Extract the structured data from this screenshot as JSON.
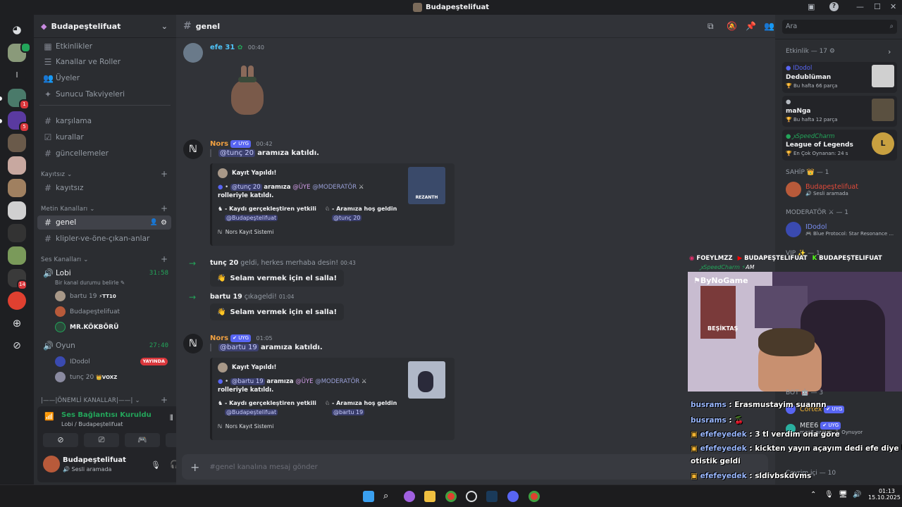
{
  "window": {
    "title": "Budapeştelifuat"
  },
  "server": {
    "name": "Budapeştelifuat",
    "top_items": [
      "Etkinlikler",
      "Kanallar ve Roller",
      "Üyeler",
      "Sunucu Takviyeleri"
    ],
    "channels_a": [
      "karşılama",
      "kurallar",
      "güncellemeler"
    ],
    "cat_kayitsiz": "Kayıtsız",
    "ch_kayitsiz": "kayıtsız",
    "cat_metin": "Metin Kanalları",
    "ch_genel": "genel",
    "ch_klipler": "klipler-ve-öne-çıkan-anlar",
    "cat_ses": "Ses Kanalları",
    "lobi": {
      "name": "Lobi",
      "time": "31:58",
      "status": "Bir kanal durumu belirle",
      "users": [
        "bartu 19",
        "Budapeştelifuat",
        "MR.KÖKBÖRÜ"
      ],
      "bartu_tag": "TT10"
    },
    "oyun": {
      "name": "Oyun",
      "time": "27:40",
      "users": [
        "IDodol",
        "tunç 20"
      ],
      "idodol_tag": "YAYINDA",
      "tunc_tag": "VOXZ"
    },
    "cat_onemli": "|——|ÖNEMLİ KANALLAR|——|",
    "rail_badges": [
      "1",
      "5",
      "14"
    ]
  },
  "voice": {
    "status": "Ses Bağlantısı Kuruldu",
    "sub": "Lobi / Budapeştelifuat"
  },
  "user": {
    "name": "Budapeştelifuat",
    "status": "Sesli aramada"
  },
  "header": {
    "channel": "genel",
    "search_placeholder": "Ara"
  },
  "messages": {
    "m1": {
      "name": "efe 31",
      "time": "00:40"
    },
    "m2": {
      "name": "Nors",
      "tag": "UYG",
      "time": "00:42",
      "mention": "@tunç 20",
      "text": "aramıza katıldı."
    },
    "embed1": {
      "title": "Kayıt Yapıldı!",
      "mention": "@tunç 20",
      "aramiza": "aramıza",
      "role1": "@ÜYE",
      "role2": "@MODERATÖR",
      "tail": "rolleriyle katıldı.",
      "f1": "- Kaydı gerçekleştiren yetkili",
      "f1v": "@Budapeştelifuat",
      "f2": "- Aramıza hoş geldin",
      "f2v": "@tunç 20",
      "footer": "Nors Kayıt Sistemi",
      "thumb": "REZANTH"
    },
    "j1": {
      "name": "tunç 20",
      "text": "geldi, herkes merhaba desin!",
      "time": "00:43",
      "btn": "Selam vermek için el salla!"
    },
    "j2": {
      "name": "bartu 19",
      "text": "çıkageldi!",
      "time": "01:04",
      "btn": "Selam vermek için el salla!"
    },
    "m3": {
      "name": "Nors",
      "tag": "UYG",
      "time": "01:05",
      "mention": "@bartu 19",
      "text": "aramıza katıldı."
    },
    "embed2": {
      "title": "Kayıt Yapıldı!",
      "mention": "@bartu 19",
      "aramiza": "aramıza",
      "role1": "@ÜYE",
      "role2": "@MODERATÖR",
      "tail": "rolleriyle katıldı.",
      "f1": "- Kaydı gerçekleştiren yetkili",
      "f1v": "@Budapeştelifuat",
      "f2": "- Aramıza hoş geldin",
      "f2v": "@bartu 19",
      "footer": "Nors Kayıt Sistemi"
    }
  },
  "composer": {
    "placeholder": "#genel kanalına mesaj gönder"
  },
  "members": {
    "activity_hdr": "Etkinlik — 17",
    "acts": [
      {
        "user": "IDodol",
        "title": "Dedublüman",
        "sub": "Bu hafta 66 parça"
      },
      {
        "user": "",
        "title": "maNga",
        "sub": "Bu hafta 12 parça"
      },
      {
        "user": "ꭙSpeedCharm",
        "title": "League of Legends",
        "sub": "En Çok Oynanan: 24 s"
      }
    ],
    "sahip_hdr": "SAHİP 👑 — 1",
    "sahip_name": "Budapeştelifuat",
    "sahip_sub": "Sesli aramada",
    "mod_hdr": "MODERATÖR ⚔ — 1",
    "mod_name": "IDodol",
    "mod_sub": "Blue Protocol: Star Resonance ...",
    "vip_hdr": "VIP ✨ — 1",
    "bot_hdr": "BOT 🤖 — 3",
    "bot1": "Cortex",
    "bot2": "MEE6",
    "bot2_sub": "mee6-games",
    "bot2_act": "Oynuyor",
    "online_hdr": "Çevrim içi — 10"
  },
  "overlay": {
    "socials": [
      "FOEYLMZZ",
      "BUDAPEŞTELIFUAT",
      "BUDAPEŞTELIFUAT"
    ],
    "watermark": "ByNoGame",
    "jersey": "BEŞİKTAŞ",
    "speed": "ꭙSpeedCharm",
    "speed_tag": "AM",
    "chat": [
      {
        "user": "busrams",
        "msg": "Erasmustayim suannn"
      },
      {
        "user": "busrams",
        "msg": "🍒"
      },
      {
        "user": "efefeyedek",
        "msg": "3 tl verdim ona göre"
      },
      {
        "user": "efefeyedek",
        "msg": "kickten yayın açayım dedi efe diye bir"
      },
      {
        "user": "",
        "msg": "otistik geldi"
      },
      {
        "user": "efefeyedek",
        "msg": "sldivbskdvms"
      }
    ]
  },
  "taskbar": {
    "time": "01:13",
    "date": "15.10.2025"
  },
  "colors": {
    "accent": "#5865f2",
    "green": "#23a55a",
    "red": "#da373c",
    "orange": "#f0b232"
  }
}
